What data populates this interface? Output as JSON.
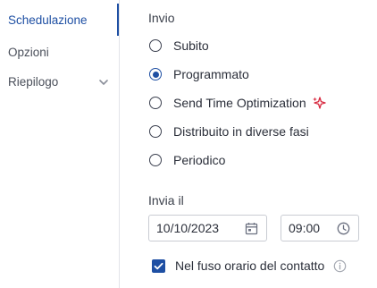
{
  "sidebar": {
    "items": [
      {
        "label": "Schedulazione",
        "active": true
      },
      {
        "label": "Opzioni",
        "active": false
      },
      {
        "label": "Riepilogo",
        "active": false,
        "icon": "chevron-down-icon"
      }
    ]
  },
  "send": {
    "section_label": "Invio",
    "options": [
      {
        "label": "Subito",
        "checked": false
      },
      {
        "label": "Programmato",
        "checked": true
      },
      {
        "label": "Send Time Optimization",
        "checked": false,
        "icon": "sparkle-icon"
      },
      {
        "label": "Distribuito in diverse fasi",
        "checked": false
      },
      {
        "label": "Periodico",
        "checked": false
      }
    ]
  },
  "send_date": {
    "label": "Invia il",
    "date_value": "10/10/2023",
    "date_icon": "calendar-icon",
    "time_value": "09:00",
    "time_icon": "clock-icon"
  },
  "timezone": {
    "label": "Nel fuso orario del contatto",
    "checked": true,
    "info_icon": "info-icon"
  },
  "colors": {
    "accent": "#1e4fa3",
    "sparkle": "#d7263d",
    "divider": "#e2e4e9"
  }
}
